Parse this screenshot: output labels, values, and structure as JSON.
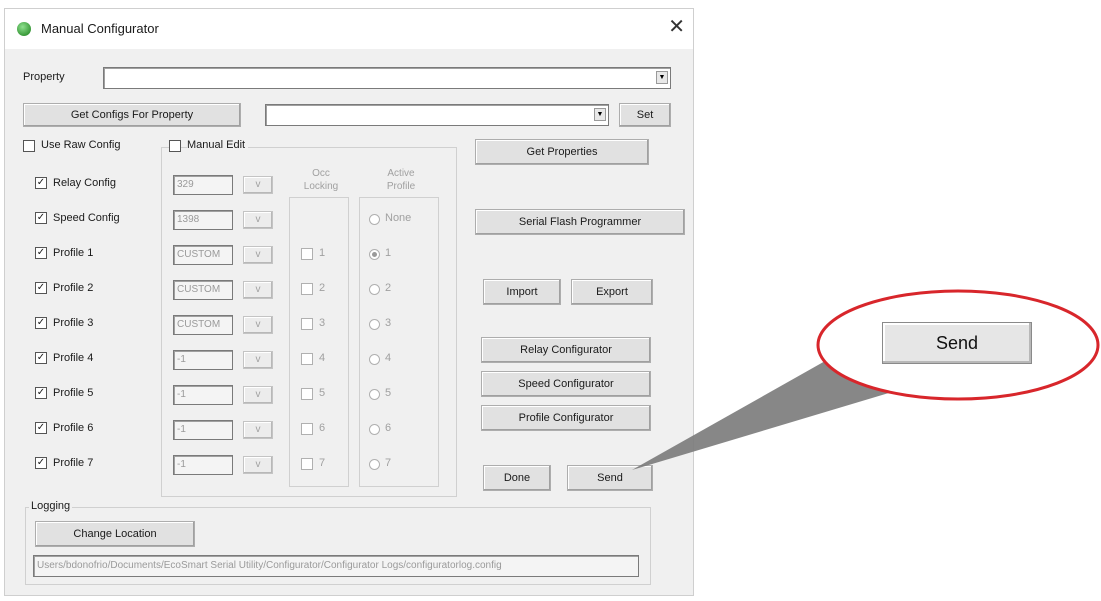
{
  "window": {
    "title": "Manual Configurator",
    "close_glyph": "✕"
  },
  "property": {
    "label": "Property",
    "value": ""
  },
  "configs": {
    "get_button": "Get Configs For Property",
    "value": "",
    "set_button": "Set"
  },
  "raw_config": {
    "label": "Use Raw Config",
    "checked": false
  },
  "manual_edit": {
    "label": "Manual Edit",
    "checked": false
  },
  "headers": {
    "occ_locking": "Occ\nLocking",
    "active_profile": "Active\nProfile"
  },
  "rows": [
    {
      "label": "Relay Config",
      "checked": true,
      "value": "329",
      "button": "v"
    },
    {
      "label": "Speed Config",
      "checked": true,
      "value": "1398",
      "button": "v"
    },
    {
      "label": "Profile 1",
      "checked": true,
      "value": "CUSTOM",
      "button": "v"
    },
    {
      "label": "Profile 2",
      "checked": true,
      "value": "CUSTOM",
      "button": "v"
    },
    {
      "label": "Profile 3",
      "checked": true,
      "value": "CUSTOM",
      "button": "v"
    },
    {
      "label": "Profile 4",
      "checked": true,
      "value": "-1",
      "button": "v"
    },
    {
      "label": "Profile 5",
      "checked": true,
      "value": "-1",
      "button": "v"
    },
    {
      "label": "Profile 6",
      "checked": true,
      "value": "-1",
      "button": "v"
    },
    {
      "label": "Profile 7",
      "checked": true,
      "value": "-1",
      "button": "v"
    }
  ],
  "occ_locking": [
    "1",
    "2",
    "3",
    "4",
    "5",
    "6",
    "7"
  ],
  "active_profile": {
    "options": [
      "None",
      "1",
      "2",
      "3",
      "4",
      "5",
      "6",
      "7"
    ],
    "selected": "1"
  },
  "buttons": {
    "get_properties": "Get Properties",
    "serial_flash": "Serial Flash Programmer",
    "import": "Import",
    "export": "Export",
    "relay_configurator": "Relay Configurator",
    "speed_configurator": "Speed Configurator",
    "profile_configurator": "Profile Configurator",
    "done": "Done",
    "send": "Send"
  },
  "logging": {
    "label": "Logging",
    "change_location": "Change Location",
    "path": "Users/bdonofrio/Documents/EcoSmart Serial Utility/Configurator/Configurator Logs/configuratorlog.config"
  },
  "callout": {
    "label": "Send",
    "ring_color": "#d8262b"
  }
}
